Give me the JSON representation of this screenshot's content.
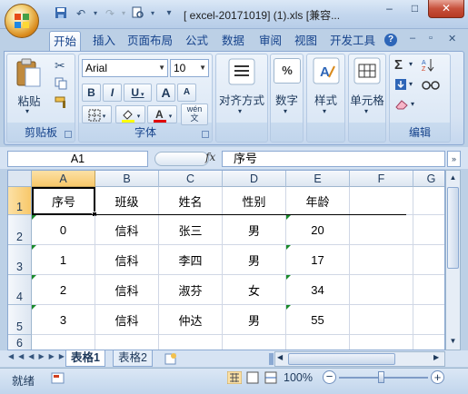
{
  "title": "[  excel-20171019] (1).xls  [兼容...",
  "window_controls": {
    "minimize": "–",
    "maximize": "□",
    "close": "✕"
  },
  "tabs": [
    "开始",
    "插入",
    "页面布局",
    "公式",
    "数据",
    "审阅",
    "视图",
    "开发工具"
  ],
  "ribbon": {
    "clipboard": {
      "paste": "粘贴",
      "group": "剪贴板"
    },
    "font": {
      "name": "Arial",
      "size": "10",
      "bold": "B",
      "italic": "I",
      "underline": "U",
      "grow": "A",
      "shrink": "A",
      "phonetic": "wén\n文",
      "group": "字体"
    },
    "alignment": {
      "label": "对齐方式"
    },
    "number": {
      "label": "数字",
      "icon_text": "%"
    },
    "styles": {
      "label": "样式"
    },
    "cells": {
      "label": "单元格"
    },
    "editing": {
      "sigma": "Σ",
      "group": "编辑"
    }
  },
  "formula_bar": {
    "name_box": "A1",
    "fx": "fx",
    "content": "序号"
  },
  "columns": [
    "A",
    "B",
    "C",
    "D",
    "E",
    "F",
    "G"
  ],
  "rows": [
    "1",
    "2",
    "3",
    "4",
    "5",
    "6"
  ],
  "table": [
    [
      "序号",
      "班级",
      "姓名",
      "性别",
      "年龄"
    ],
    [
      "0",
      "信科",
      "张三",
      "男",
      "20"
    ],
    [
      "1",
      "信科",
      "李四",
      "男",
      "17"
    ],
    [
      "2",
      "信科",
      "淑芬",
      "女",
      "34"
    ],
    [
      "3",
      "信科",
      "仲达",
      "男",
      "55"
    ]
  ],
  "sheet_tabs": [
    "表格1",
    "表格2"
  ],
  "status": {
    "ready": "就绪",
    "zoom": "100%",
    "minus": "−",
    "plus": "+"
  },
  "colors": {
    "accent": "#15428b",
    "ribbon": "#d6e3f3",
    "selected_header": "#f8c86a"
  }
}
